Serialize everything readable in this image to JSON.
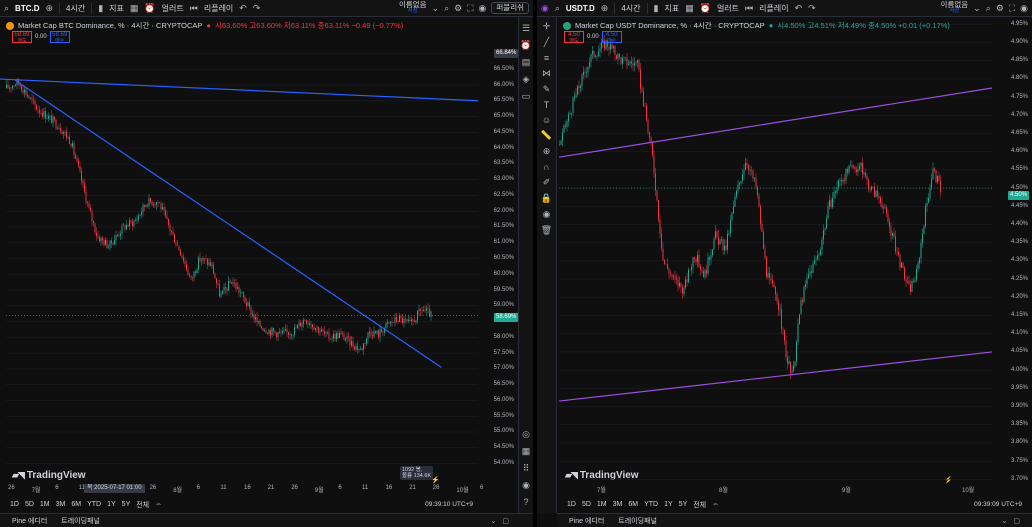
{
  "left": {
    "symbol": "BTC.D",
    "interval": "4시간",
    "menu": [
      "지표",
      "얼러트",
      "리플레이"
    ],
    "unnamed": "이름없음",
    "unnamed_sub": "저장",
    "replay_btn": "퍼블리쉬",
    "legend_title": "Market Cap BTC Dominance, %  · 4시간 · CRYPTOCAP",
    "legend_ohlc": "시63.60%  고63.60%  저63.11%  종63.11%  −0.49 (−0.77%)",
    "sell_price": "58.69",
    "sell_label": "매도",
    "spread": "0.00",
    "buy_price": "58.69",
    "buy_label": "매수",
    "y_ticks": [
      "67.00%",
      "66.50%",
      "66.00%",
      "65.50%",
      "65.00%",
      "64.50%",
      "64.00%",
      "63.50%",
      "63.00%",
      "62.50%",
      "62.00%",
      "61.50%",
      "61.00%",
      "60.50%",
      "60.00%",
      "59.50%",
      "59.00%",
      "58.50%",
      "58.00%",
      "57.50%",
      "57.00%",
      "56.50%",
      "56.00%",
      "55.50%",
      "55.00%",
      "54.50%",
      "54.00%"
    ],
    "current_price_tag": "58.69%",
    "top_price_tag": "66.84%",
    "x_ticks": [
      "26",
      "7월",
      "6",
      "11",
      "16",
      "21",
      "26",
      "8월",
      "6",
      "11",
      "16",
      "21",
      "26",
      "9월",
      "6",
      "11",
      "16",
      "21",
      "26",
      "10월",
      "6"
    ],
    "crosshair_date": "목 2025-07-17   01:00",
    "vol_badge_line1": "1092 봉,",
    "vol_badge_line2": "볼륨 134.6K",
    "ranges": [
      "1D",
      "5D",
      "1M",
      "3M",
      "6M",
      "YTD",
      "1Y",
      "5Y",
      "전체"
    ],
    "clock": "09:39:10 UTC+9",
    "brand": "TradingView"
  },
  "right": {
    "symbol": "USDT.D",
    "interval": "4시간",
    "menu": [
      "지표",
      "얼러트",
      "리플레이"
    ],
    "unnamed": "이름없음",
    "unnamed_sub": "저장",
    "legend_title": "Market Cap USDT Dominance, %  · 4시간 · CRYPTOCAP",
    "legend_ohlc": "시4.50%  고4.51%  저4.49%  종4.50%  +0.01 (+0.17%)",
    "sell_price": "4.50",
    "sell_label": "매도",
    "spread": "0.00",
    "buy_price": "4.50",
    "buy_label": "매수",
    "y_ticks": [
      "4.95%",
      "4.90%",
      "4.85%",
      "4.80%",
      "4.75%",
      "4.70%",
      "4.65%",
      "4.60%",
      "4.55%",
      "4.50%",
      "4.45%",
      "4.40%",
      "4.35%",
      "4.30%",
      "4.25%",
      "4.20%",
      "4.15%",
      "4.10%",
      "4.05%",
      "4.00%",
      "3.95%",
      "3.90%",
      "3.85%",
      "3.80%",
      "3.75%",
      "3.70%"
    ],
    "current_price_tag": "4.50%",
    "x_ticks": [
      "7월",
      "8월",
      "9월",
      "10월"
    ],
    "ranges": [
      "1D",
      "5D",
      "1M",
      "3M",
      "6M",
      "YTD",
      "1Y",
      "5Y",
      "전체"
    ],
    "clock": "09:39:09 UTC+9",
    "brand": "TradingView"
  },
  "footer": {
    "pine_editor": "Pine 에디터",
    "trading_panel": "트레이딩패널"
  },
  "colors": {
    "up": "#22ab94",
    "down": "#f23645",
    "trend_blue": "#2962ff",
    "channel_purple": "#9c4fe0",
    "background": "#0f0f0f"
  },
  "chart_data": [
    {
      "type": "candlestick",
      "title": "Market Cap BTC Dominance, %",
      "ylabel": "%",
      "ylim": [
        53.7,
        67.3
      ],
      "x_range": [
        "2025-06-26",
        "2025-10-07"
      ],
      "trend_lines": [
        {
          "from": [
            "2025-06-23",
            66.2
          ],
          "to": [
            "2025-10-07",
            65.5
          ]
        },
        {
          "from": [
            "2025-06-28",
            66.15
          ],
          "to": [
            "2025-09-29",
            57.05
          ]
        }
      ],
      "path": [
        [
          0,
          65.9
        ],
        [
          4,
          66.1
        ],
        [
          10,
          65.3
        ],
        [
          18,
          64.7
        ],
        [
          22,
          64.2
        ],
        [
          25,
          63.2
        ],
        [
          28,
          62.1
        ],
        [
          31,
          61.2
        ],
        [
          35,
          60.9
        ],
        [
          40,
          61.5
        ],
        [
          44,
          61.7
        ],
        [
          48,
          62.3
        ],
        [
          52,
          62.3
        ],
        [
          56,
          61.4
        ],
        [
          60,
          60.6
        ],
        [
          63,
          59.8
        ],
        [
          66,
          60.5
        ],
        [
          70,
          60.3
        ],
        [
          73,
          59.3
        ],
        [
          77,
          59.8
        ],
        [
          80,
          59.4
        ],
        [
          83,
          58.9
        ],
        [
          86,
          58.4
        ],
        [
          90,
          58.2
        ],
        [
          94,
          58.1
        ],
        [
          98,
          58.2
        ],
        [
          102,
          58.6
        ],
        [
          106,
          58.3
        ],
        [
          110,
          58.0
        ],
        [
          114,
          58.1
        ],
        [
          118,
          57.8
        ],
        [
          121,
          57.6
        ],
        [
          124,
          58.2
        ],
        [
          127,
          58.1
        ],
        [
          130,
          58.4
        ],
        [
          134,
          58.6
        ],
        [
          138,
          58.4
        ],
        [
          142,
          58.9
        ],
        [
          145,
          58.7
        ]
      ],
      "last": 58.69
    },
    {
      "type": "candlestick",
      "title": "Market Cap USDT Dominance, %",
      "ylabel": "%",
      "ylim": [
        3.69,
        4.97
      ],
      "x_range": [
        "2025-06-20",
        "2025-10-07"
      ],
      "channel_lines": [
        {
          "from": [
            "2025-06-20",
            4.585
          ],
          "to": [
            "2025-10-07",
            4.775
          ]
        },
        {
          "from": [
            "2025-06-20",
            3.915
          ],
          "to": [
            "2025-10-07",
            4.05
          ]
        }
      ],
      "path": [
        [
          0,
          4.62
        ],
        [
          6,
          4.75
        ],
        [
          12,
          4.86
        ],
        [
          18,
          4.9
        ],
        [
          24,
          4.85
        ],
        [
          30,
          4.84
        ],
        [
          36,
          4.58
        ],
        [
          40,
          4.3
        ],
        [
          44,
          4.25
        ],
        [
          48,
          4.22
        ],
        [
          52,
          4.32
        ],
        [
          56,
          4.26
        ],
        [
          60,
          4.37
        ],
        [
          64,
          4.33
        ],
        [
          68,
          4.48
        ],
        [
          72,
          4.58
        ],
        [
          76,
          4.5
        ],
        [
          80,
          4.26
        ],
        [
          84,
          4.2
        ],
        [
          88,
          4.02
        ],
        [
          90,
          3.98
        ],
        [
          93,
          4.18
        ],
        [
          96,
          4.26
        ],
        [
          100,
          4.32
        ],
        [
          104,
          4.45
        ],
        [
          108,
          4.52
        ],
        [
          112,
          4.55
        ],
        [
          116,
          4.56
        ],
        [
          120,
          4.5
        ],
        [
          124,
          4.47
        ],
        [
          128,
          4.38
        ],
        [
          132,
          4.28
        ],
        [
          135,
          4.22
        ],
        [
          138,
          4.27
        ],
        [
          141,
          4.43
        ],
        [
          144,
          4.55
        ],
        [
          147,
          4.5
        ]
      ],
      "last": 4.5
    }
  ]
}
